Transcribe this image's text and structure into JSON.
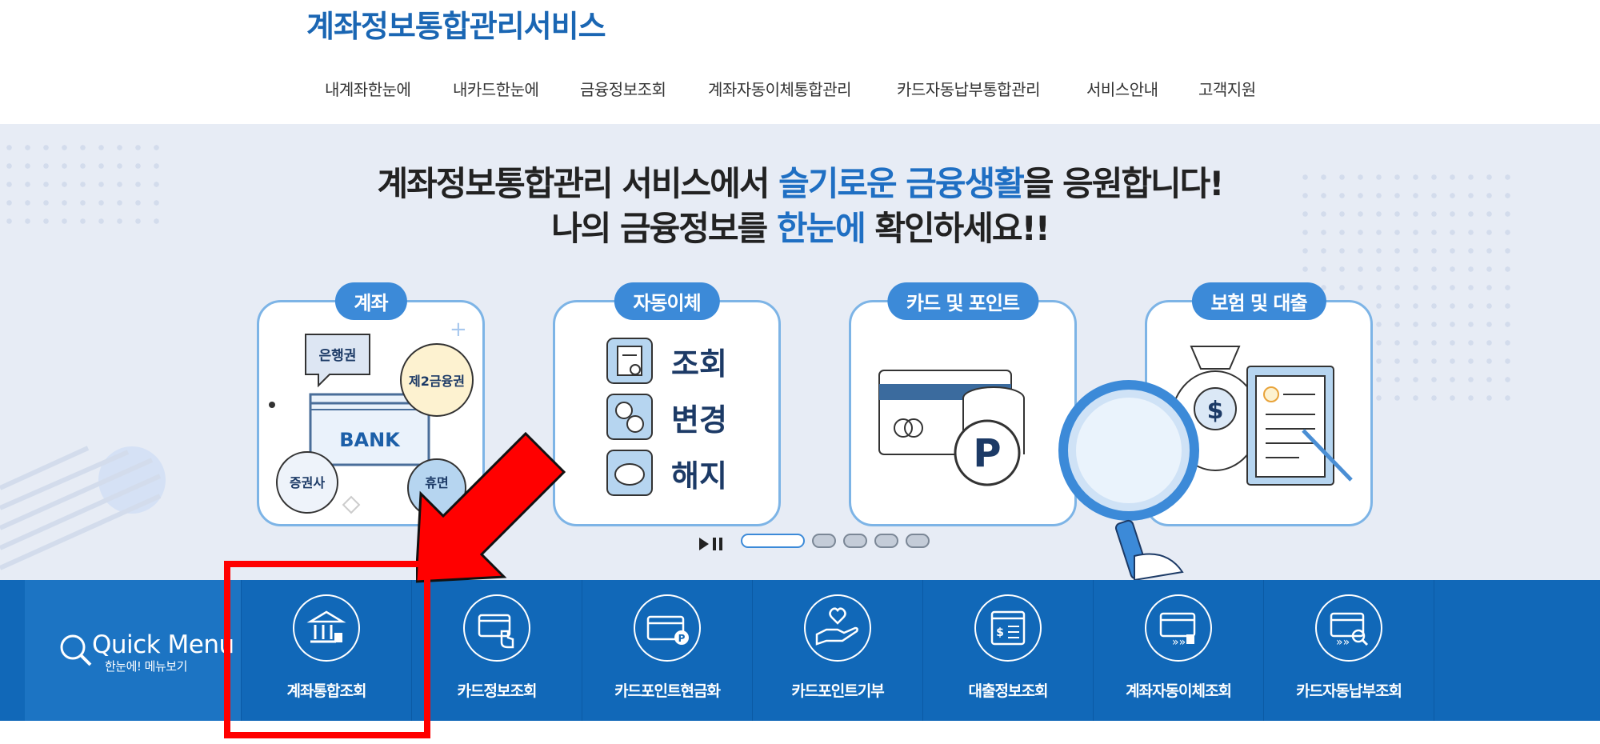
{
  "header": {
    "site_title": "계좌정보통합관리서비스",
    "nav": [
      "내계좌한눈에",
      "내카드한눈에",
      "금융정보조회",
      "계좌자동이체통합관리",
      "카드자동납부통합관리",
      "서비스안내",
      "고객지원"
    ]
  },
  "hero": {
    "headline_prefix": "계좌정보통합관리 서비스에서 ",
    "headline_highlight": "슬기로운 금융생활",
    "headline_suffix": "을 응원합니다!",
    "subline_prefix": "나의 금융정보를 ",
    "subline_highlight": "한눈에",
    "subline_suffix": " 확인하세요!!",
    "cards": [
      {
        "tag": "계좌",
        "bubbles": {
          "bank": "은행권",
          "second": "제2금융권",
          "securities": "증권사",
          "dormant": "휴면\n계좌"
        },
        "center": "BANK"
      },
      {
        "tag": "자동이체",
        "items": [
          "조회",
          "변경",
          "해지"
        ]
      },
      {
        "tag": "카드 및 포인트",
        "point_symbol": "P"
      },
      {
        "tag": "보험 및 대출",
        "currency_symbol": "$"
      }
    ],
    "slider": {
      "total_pages": 5,
      "active_page": 1,
      "state": "playing"
    }
  },
  "quick_menu": {
    "title": "Quick Menu",
    "subtitle": "한눈에! 메뉴보기",
    "items": [
      {
        "label": "계좌통합조회",
        "icon": "bank-icon"
      },
      {
        "label": "카드정보조회",
        "icon": "card-touch-icon"
      },
      {
        "label": "카드포인트현금화",
        "icon": "card-point-icon"
      },
      {
        "label": "카드포인트기부",
        "icon": "heart-hand-icon"
      },
      {
        "label": "대출정보조회",
        "icon": "loan-doc-icon"
      },
      {
        "label": "계좌자동이체조회",
        "icon": "auto-transfer-icon"
      },
      {
        "label": "카드자동납부조회",
        "icon": "card-search-icon"
      }
    ]
  },
  "annotation": {
    "highlight_color": "#ff0000"
  }
}
